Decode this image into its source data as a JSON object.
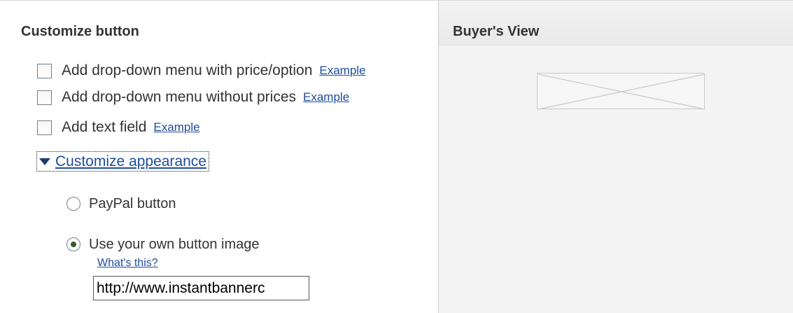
{
  "customize": {
    "title": "Customize button",
    "options": [
      {
        "label": "Add drop-down menu with price/option",
        "example": "Example"
      },
      {
        "label": "Add drop-down menu without prices",
        "example": "Example"
      },
      {
        "label": "Add text field",
        "example": "Example"
      }
    ],
    "appearance_toggle": "Customize appearance",
    "radio_paypal": "PayPal button",
    "radio_own": "Use your own button image",
    "whats_this": "What's this?",
    "image_url_value": "http://www.instantbannerc"
  },
  "buyer_view": {
    "title": "Buyer's View",
    "preview_icon": "broken-image-placeholder-icon"
  }
}
